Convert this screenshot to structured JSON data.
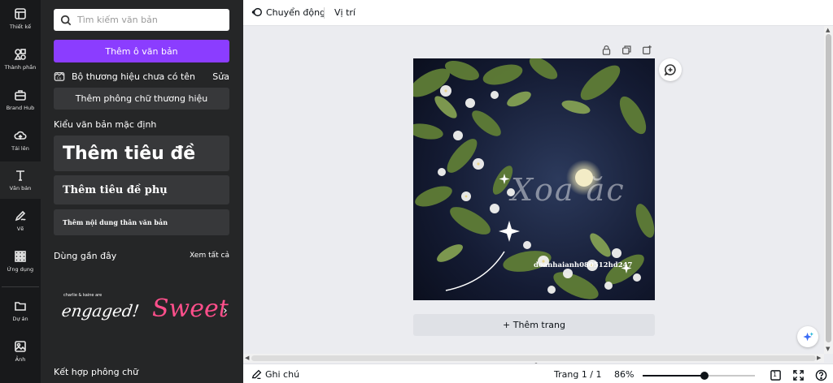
{
  "rail": {
    "items": [
      {
        "label": "Thiết kế",
        "icon": "layout-icon"
      },
      {
        "label": "Thành phần",
        "icon": "elements-icon"
      },
      {
        "label": "Brand Hub",
        "icon": "briefcase-icon"
      },
      {
        "label": "Tải lên",
        "icon": "cloud-upload-icon"
      },
      {
        "label": "Văn bản",
        "icon": "text-icon"
      },
      {
        "label": "Vẽ",
        "icon": "draw-icon"
      },
      {
        "label": "Ứng dụng",
        "icon": "apps-icon"
      },
      {
        "label": "Dự án",
        "icon": "folder-icon"
      },
      {
        "label": "Ảnh",
        "icon": "image-icon"
      }
    ]
  },
  "panel": {
    "search_placeholder": "Tìm kiếm văn bản",
    "add_textbox_label": "Thêm ô văn bản",
    "brand_kit_name": "Bộ thương hiệu chưa có tên",
    "brand_kit_edit": "Sửa",
    "add_brand_font_label": "Thêm phông chữ thương hiệu",
    "default_styles_title": "Kiểu văn bản mặc định",
    "heading_label": "Thêm tiêu đề",
    "subheading_label": "Thêm tiêu đề phụ",
    "body_label": "Thêm nội dung thân văn bản",
    "recent_title": "Dùng gần đây",
    "see_all_label": "Xem tất cả",
    "thumb1_small": "charlie & kaine are",
    "thumb1_main": "engaged!",
    "thumb2_main": "Sweet",
    "font_combos_title": "Kết hợp phông chữ"
  },
  "topbar": {
    "motion_label": "Chuyển động",
    "position_label": "Vị trí"
  },
  "canvas": {
    "design_script_text": "Xoa ăc",
    "design_handle_text": "doanhaianh080512hd247",
    "add_page_label": "+ Thêm trang"
  },
  "bottombar": {
    "notes_label": "Ghi chú",
    "page_indicator": "Trang 1 / 1",
    "zoom_label": "86%",
    "zoom_value": 0.55,
    "grid_view_count": "1"
  },
  "colors": {
    "accent": "#8b3dff",
    "panel_bg": "#252627",
    "rail_bg": "#18191b",
    "canvas_bg": "#ebecf0"
  }
}
